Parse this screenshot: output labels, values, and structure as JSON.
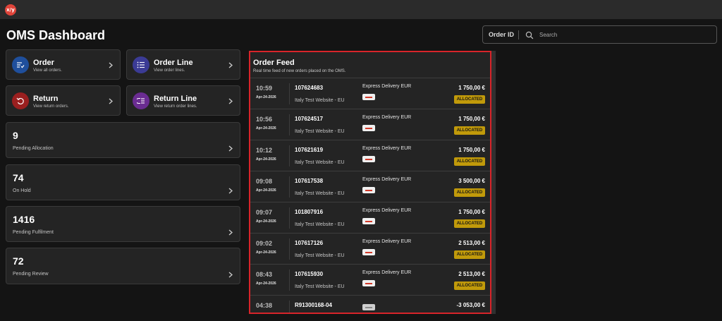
{
  "app": {
    "logo_text": "x/y"
  },
  "page": {
    "title": "OMS Dashboard"
  },
  "search": {
    "mode_label": "Order ID",
    "placeholder": "Search",
    "value": ""
  },
  "colors": {
    "accent_red": "#d8242a",
    "badge_allocated": "#c19a0a",
    "order_icon": "#1f4f9c",
    "order_line_icon": "#3b3b95",
    "return_icon": "#9a1f1f",
    "return_line_icon": "#6a2c91"
  },
  "tiles": [
    {
      "title": "Order",
      "subtitle": "View all orders.",
      "icon": "list-check-icon"
    },
    {
      "title": "Order Line",
      "subtitle": "View order lines.",
      "icon": "bulleted-list-icon"
    },
    {
      "title": "Return",
      "subtitle": "View return orders.",
      "icon": "return-arrow-icon"
    },
    {
      "title": "Return Line",
      "subtitle": "View return order lines.",
      "icon": "return-list-icon"
    }
  ],
  "stats": [
    {
      "count": "9",
      "label": "Pending Allocation"
    },
    {
      "count": "74",
      "label": "On Hold"
    },
    {
      "count": "1416",
      "label": "Pending Fulfilment"
    },
    {
      "count": "72",
      "label": "Pending Review"
    }
  ],
  "feed": {
    "title": "Order Feed",
    "subtitle": "Real time feed of new orders placed on the OMS.",
    "orders": [
      {
        "time": "10:59",
        "date": "Apr-24-2026",
        "order_id": "107624683",
        "channel": "Italy Test Website - EU",
        "shipping": "Express Delivery EUR",
        "amount": "1 750,00 €",
        "status": "ALLOCATED"
      },
      {
        "time": "10:56",
        "date": "Apr-24-2026",
        "order_id": "107624517",
        "channel": "Italy Test Website - EU",
        "shipping": "Express Delivery EUR",
        "amount": "1 750,00 €",
        "status": "ALLOCATED"
      },
      {
        "time": "10:12",
        "date": "Apr-24-2026",
        "order_id": "107621619",
        "channel": "Italy Test Website - EU",
        "shipping": "Express Delivery EUR",
        "amount": "1 750,00 €",
        "status": "ALLOCATED"
      },
      {
        "time": "09:08",
        "date": "Apr-24-2026",
        "order_id": "107617538",
        "channel": "Italy Test Website - EU",
        "shipping": "Express Delivery EUR",
        "amount": "3 500,00 €",
        "status": "ALLOCATED"
      },
      {
        "time": "09:07",
        "date": "Apr-24-2026",
        "order_id": "101807916",
        "channel": "Italy Test Website - EU",
        "shipping": "Express Delivery EUR",
        "amount": "1 750,00 €",
        "status": "ALLOCATED"
      },
      {
        "time": "09:02",
        "date": "Apr-24-2026",
        "order_id": "107617126",
        "channel": "Italy Test Website - EU",
        "shipping": "Express Delivery EUR",
        "amount": "2 513,00 €",
        "status": "ALLOCATED"
      },
      {
        "time": "08:43",
        "date": "Apr-24-2026",
        "order_id": "107615930",
        "channel": "Italy Test Website - EU",
        "shipping": "Express Delivery EUR",
        "amount": "2 513,00 €",
        "status": "ALLOCATED"
      },
      {
        "time": "04:38",
        "date": "",
        "order_id": "R91300168-04",
        "channel": "",
        "shipping": "",
        "amount": "-3 053,00 €",
        "status": ""
      }
    ]
  }
}
